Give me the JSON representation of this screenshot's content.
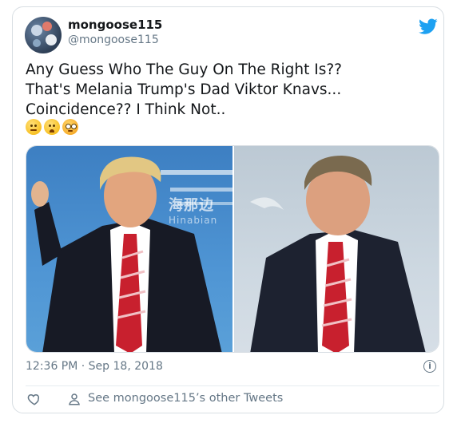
{
  "tweet": {
    "author_name": "mongoose115",
    "author_handle": "@mongoose115",
    "text_lines": [
      "Any Guess Who The Guy On The Right Is??",
      "That's Melania Trump's Dad Viktor Knavs...",
      "Coincidence??  I Think Not.."
    ],
    "emojis": [
      "neutral-face-emoji",
      "worried-face-emoji",
      "flushed-face-emoji"
    ],
    "watermark": "海那边",
    "watermark_sub": "Hinabian",
    "timestamp": "12:36 PM · Sep 18, 2018",
    "info_label": "i",
    "other_tweets": "See mongoose115’s other Tweets"
  },
  "colors": {
    "twitter_blue": "#1da1f2",
    "text_primary": "#14171a",
    "text_secondary": "#657786",
    "border": "#d8dee3"
  }
}
